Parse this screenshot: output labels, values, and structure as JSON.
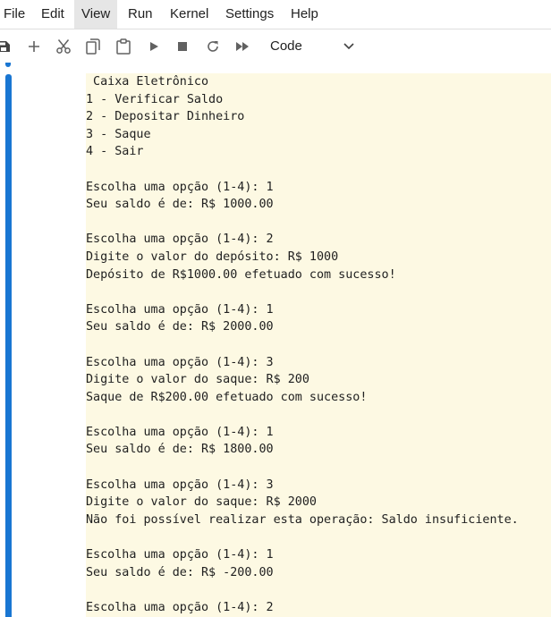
{
  "menu": {
    "items": [
      "File",
      "Edit",
      "View",
      "Run",
      "Kernel",
      "Settings",
      "Help"
    ],
    "active": "View"
  },
  "toolbar": {
    "buttons": [
      "save-icon",
      "add-icon",
      "cut-icon",
      "copy-icon",
      "paste-icon",
      "run-icon",
      "stop-icon",
      "restart-icon",
      "fast-forward-icon"
    ],
    "cell_type": "Code"
  },
  "output": {
    "lines": [
      " Caixa Eletrônico",
      "1 - Verificar Saldo",
      "2 - Depositar Dinheiro",
      "3 - Saque",
      "4 - Sair",
      "",
      "Escolha uma opção (1-4): 1",
      "Seu saldo é de: R$ 1000.00",
      "",
      "Escolha uma opção (1-4): 2",
      "Digite o valor do depósito: R$ 1000",
      "Depósito de R$1000.00 efetuado com sucesso!",
      "",
      "Escolha uma opção (1-4): 1",
      "Seu saldo é de: R$ 2000.00",
      "",
      "Escolha uma opção (1-4): 3",
      "Digite o valor do saque: R$ 200",
      "Saque de R$200.00 efetuado com sucesso!",
      "",
      "Escolha uma opção (1-4): 1",
      "Seu saldo é de: R$ 1800.00",
      "",
      "Escolha uma opção (1-4): 3",
      "Digite o valor do saque: R$ 2000",
      "Não foi possível realizar esta operação: Saldo insuficiente.",
      "",
      "Escolha uma opção (1-4): 1",
      "Seu saldo é de: R$ -200.00",
      "",
      "Escolha uma opção (1-4): 2"
    ]
  },
  "colors": {
    "accent": "#1976d2",
    "output_bg": "#fdf9e3",
    "menu_active_bg": "#e6e6e6"
  }
}
